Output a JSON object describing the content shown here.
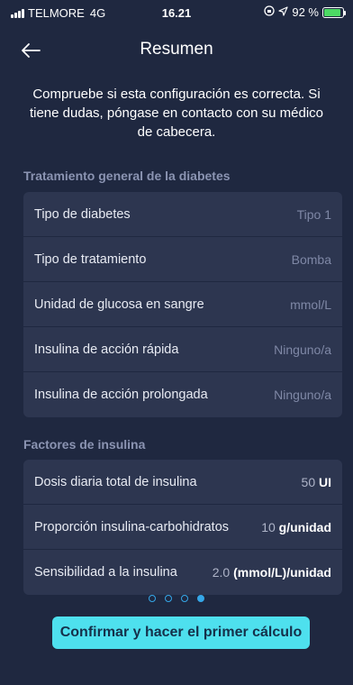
{
  "status_bar": {
    "carrier": "TELMORE",
    "network": "4G",
    "time": "16.21",
    "battery_percent": "92 %",
    "battery_level": 0.92
  },
  "header": {
    "title": "Resumen"
  },
  "intro_text": "Compruebe si esta configuración es correcta. Si tiene dudas, póngase en contacto con su médico de cabecera.",
  "sections": [
    {
      "title": "Tratamiento general de la diabetes",
      "rows": [
        {
          "label": "Tipo de diabetes",
          "value": "Tipo 1"
        },
        {
          "label": "Tipo de tratamiento",
          "value": "Bomba"
        },
        {
          "label": "Unidad de glucosa en sangre",
          "value": "mmol/L"
        },
        {
          "label": "Insulina de acción rápida",
          "value": "Ninguno/a"
        },
        {
          "label": "Insulina de acción prolongada",
          "value": "Ninguno/a"
        }
      ]
    },
    {
      "title": "Factores de insulina",
      "rows": [
        {
          "label": "Dosis diaria total de insulina",
          "value": "50",
          "unit": "UI"
        },
        {
          "label": "Proporción insulina-carbohidratos",
          "value": "10",
          "unit": "g/unidad"
        },
        {
          "label": "Sensibilidad a la insulina",
          "value": "2.0",
          "unit": "(mmol/L)/unidad"
        }
      ]
    }
  ],
  "pager": {
    "total_pages": 4,
    "current_page": 4
  },
  "confirm_button_label": "Confirmar y hacer el primer cálculo",
  "colors": {
    "background": "#1f2840",
    "card": "#2d3650",
    "accent": "#4ee0ee",
    "pager": "#35a7e8"
  }
}
